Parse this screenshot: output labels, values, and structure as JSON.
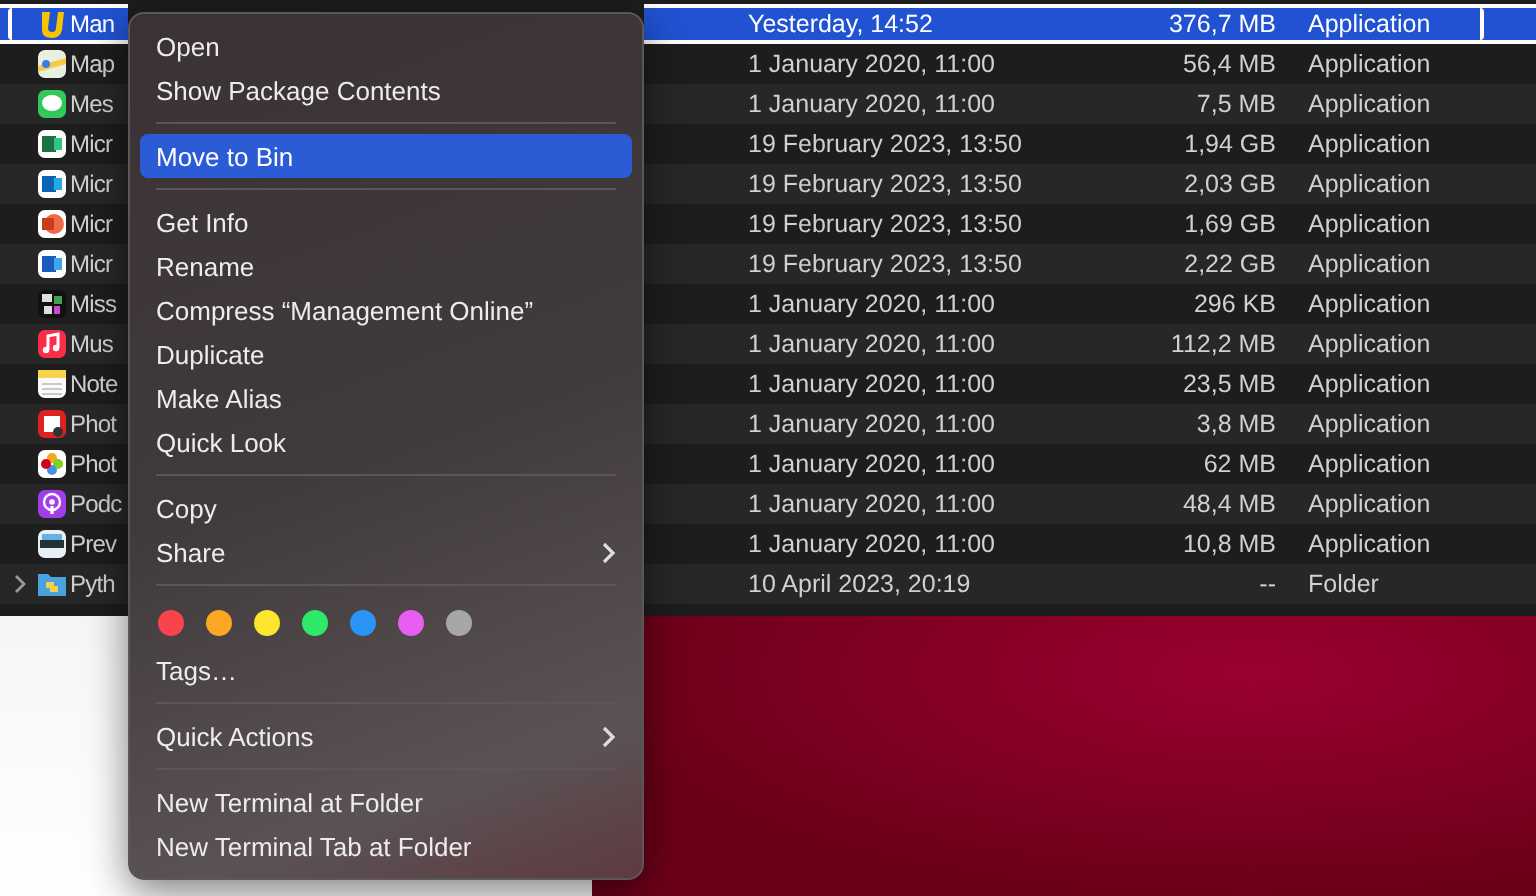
{
  "finder": {
    "rows": [
      {
        "name": "Man",
        "date": "Yesterday, 14:52",
        "size": "376,7 MB",
        "kind": "Application",
        "selected": true
      },
      {
        "name": "Map",
        "date": "1 January 2020, 11:00",
        "size": "56,4 MB",
        "kind": "Application",
        "selected": false
      },
      {
        "name": "Mes",
        "date": "1 January 2020, 11:00",
        "size": "7,5 MB",
        "kind": "Application",
        "selected": false
      },
      {
        "name": "Micr",
        "date": "19 February 2023, 13:50",
        "size": "1,94 GB",
        "kind": "Application",
        "selected": false
      },
      {
        "name": "Micr",
        "date": "19 February 2023, 13:50",
        "size": "2,03 GB",
        "kind": "Application",
        "selected": false
      },
      {
        "name": "Micr",
        "date": "19 February 2023, 13:50",
        "size": "1,69 GB",
        "kind": "Application",
        "selected": false
      },
      {
        "name": "Micr",
        "date": "19 February 2023, 13:50",
        "size": "2,22 GB",
        "kind": "Application",
        "selected": false
      },
      {
        "name": "Miss",
        "date": "1 January 2020, 11:00",
        "size": "296 KB",
        "kind": "Application",
        "selected": false
      },
      {
        "name": "Mus",
        "date": "1 January 2020, 11:00",
        "size": "112,2 MB",
        "kind": "Application",
        "selected": false
      },
      {
        "name": "Note",
        "date": "1 January 2020, 11:00",
        "size": "23,5 MB",
        "kind": "Application",
        "selected": false
      },
      {
        "name": "Phot",
        "date": "1 January 2020, 11:00",
        "size": "3,8 MB",
        "kind": "Application",
        "selected": false
      },
      {
        "name": "Phot",
        "date": "1 January 2020, 11:00",
        "size": "62 MB",
        "kind": "Application",
        "selected": false
      },
      {
        "name": "Podc",
        "date": "1 January 2020, 11:00",
        "size": "48,4 MB",
        "kind": "Application",
        "selected": false
      },
      {
        "name": "Prev",
        "date": "1 January 2020, 11:00",
        "size": "10,8 MB",
        "kind": "Application",
        "selected": false
      },
      {
        "name": "Pyth",
        "date": "10 April 2023, 20:19",
        "size": "--",
        "kind": "Folder",
        "selected": false,
        "expanded": false
      }
    ]
  },
  "context_menu": {
    "items": [
      {
        "kind": "item",
        "label": "Open",
        "selected": false,
        "submenu": false
      },
      {
        "kind": "item",
        "label": "Show Package Contents",
        "selected": false,
        "submenu": false
      },
      {
        "kind": "separator"
      },
      {
        "kind": "item",
        "label": "Move to Bin",
        "selected": true,
        "submenu": false
      },
      {
        "kind": "separator"
      },
      {
        "kind": "item",
        "label": "Get Info",
        "selected": false,
        "submenu": false
      },
      {
        "kind": "item",
        "label": "Rename",
        "selected": false,
        "submenu": false
      },
      {
        "kind": "item",
        "label": "Compress “Management Online”",
        "selected": false,
        "submenu": false
      },
      {
        "kind": "item",
        "label": "Duplicate",
        "selected": false,
        "submenu": false
      },
      {
        "kind": "item",
        "label": "Make Alias",
        "selected": false,
        "submenu": false
      },
      {
        "kind": "item",
        "label": "Quick Look",
        "selected": false,
        "submenu": false
      },
      {
        "kind": "separator"
      },
      {
        "kind": "item",
        "label": "Copy",
        "selected": false,
        "submenu": false
      },
      {
        "kind": "item",
        "label": "Share",
        "selected": false,
        "submenu": true
      },
      {
        "kind": "separator"
      },
      {
        "kind": "tags",
        "dots": [
          {
            "color": "#f9444e"
          },
          {
            "color": "#fca724"
          },
          {
            "color": "#fde52f"
          },
          {
            "color": "#2ee86a"
          },
          {
            "color": "#2b95f7"
          },
          {
            "color": "#e75ef0"
          },
          {
            "color": "#a6a6a8"
          }
        ]
      },
      {
        "kind": "item",
        "label": "Tags…",
        "selected": false,
        "submenu": false
      },
      {
        "kind": "separator"
      },
      {
        "kind": "item",
        "label": "Quick Actions",
        "selected": false,
        "submenu": true
      },
      {
        "kind": "separator"
      },
      {
        "kind": "item",
        "label": "New Terminal at Folder",
        "selected": false,
        "submenu": false
      },
      {
        "kind": "item",
        "label": "New Terminal Tab at Folder",
        "selected": false,
        "submenu": false
      }
    ]
  }
}
